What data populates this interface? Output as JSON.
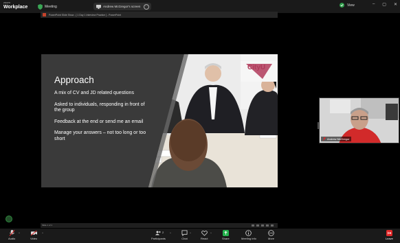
{
  "app": {
    "brand_small": "zoom",
    "brand_large": "Workplace"
  },
  "topbar": {
    "meeting_label": "Meeting",
    "share_pill_label": "Andrew McGregor's screen",
    "share_pill_options": "⋯",
    "view_label": "View",
    "win_min": "–",
    "win_max": "▢",
    "win_close": "✕"
  },
  "shared_screen": {
    "window_title": "PowerPoint Slide Show - [ 1 Day 1 Interview Practice ] - PowerPoint",
    "status_text": "Slide 1 of 1"
  },
  "slide": {
    "heading": "Approach",
    "bullets": [
      "A mix of CV and JD related questions",
      "Asked to individuals, responding in front of the group",
      "Feedback at the end or send me an email",
      "Manage your answers – not too long or too short"
    ],
    "logo_text": "CityU"
  },
  "participant": {
    "name": "Andrew McGregor"
  },
  "toolbar": {
    "audio": "Audio",
    "video": "Video",
    "participants": "Participants",
    "participants_count": "2",
    "chat": "Chat",
    "react": "React",
    "share": "Share",
    "meeting_info": "Meeting info",
    "more": "More",
    "leave": "Leave"
  },
  "colors": {
    "share_green": "#24b14d",
    "leave_red": "#e02828",
    "audio_muted_red": "#e02828",
    "slide_dark_panel": "#3a3a3a"
  }
}
